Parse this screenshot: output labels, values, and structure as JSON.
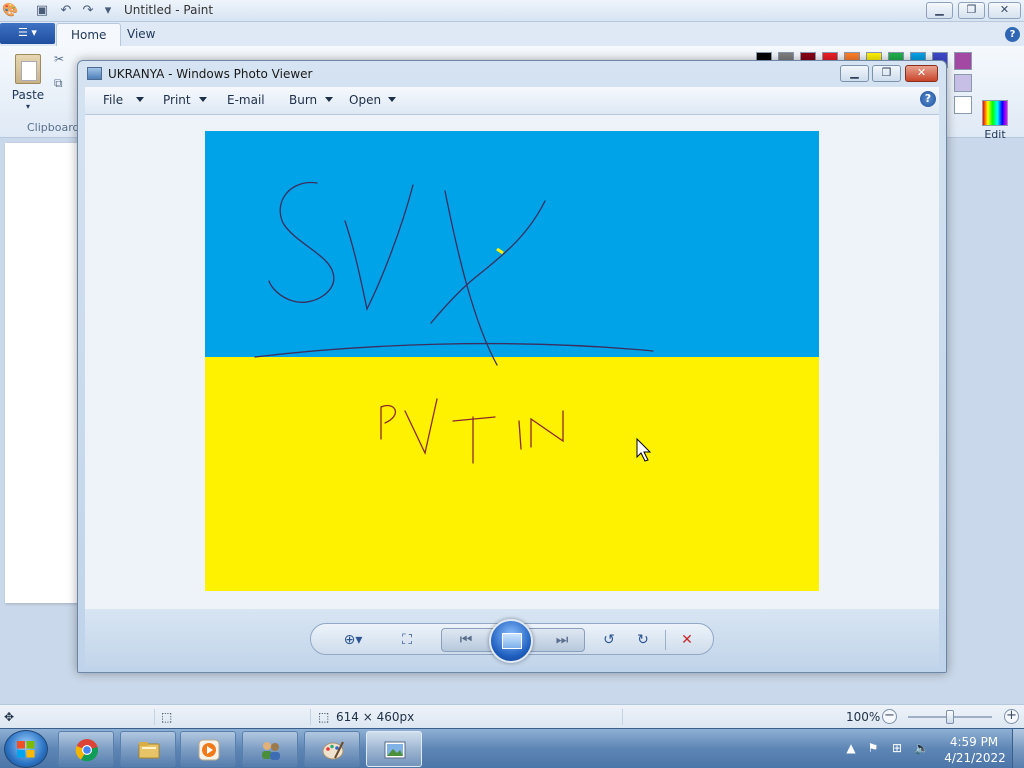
{
  "paint": {
    "title": "Untitled - Paint",
    "tabs": [
      {
        "label": "Home"
      },
      {
        "label": "View"
      }
    ],
    "paste_label": "Paste",
    "clipboard_group_label": "Clipboard",
    "edit_colors_label": "Edit colors",
    "status": {
      "image_size": "614 × 460px",
      "zoom_level": "100%",
      "zoom_fraction": 0.5
    },
    "palette": [
      "#000000",
      "#7f7f7f",
      "#880015",
      "#ed1c24",
      "#ff7f27",
      "#fff200",
      "#22b14c",
      "#00a2e8",
      "#3f48cc",
      "#a349a4",
      "#c8bfe7",
      "#ffffff"
    ]
  },
  "photo_viewer": {
    "title": "UKRANYA - Windows Photo Viewer",
    "menu": [
      {
        "label": "File",
        "has_dropdown": true
      },
      {
        "label": "Print",
        "has_dropdown": true
      },
      {
        "label": "E-mail",
        "has_dropdown": false
      },
      {
        "label": "Burn",
        "has_dropdown": true
      },
      {
        "label": "Open",
        "has_dropdown": true
      }
    ],
    "image": {
      "top_color": "#00a2e8",
      "bottom_color": "#fff200",
      "stroke_top": "#3a2f5e",
      "stroke_bottom": "#8c2a2a"
    },
    "controls": [
      "zoom-icon",
      "fit-to-window-icon",
      "previous-icon",
      "slideshow-icon",
      "next-icon",
      "rotate-counterclockwise-icon",
      "rotate-clockwise-icon",
      "delete-icon"
    ]
  },
  "taskbar": {
    "items": [
      "chrome-icon",
      "file-explorer-icon",
      "media-player-icon",
      "network-users-icon",
      "paint-icon",
      "photo-viewer-icon"
    ],
    "clock_time": "4:59 PM",
    "clock_date": "4/21/2022"
  }
}
